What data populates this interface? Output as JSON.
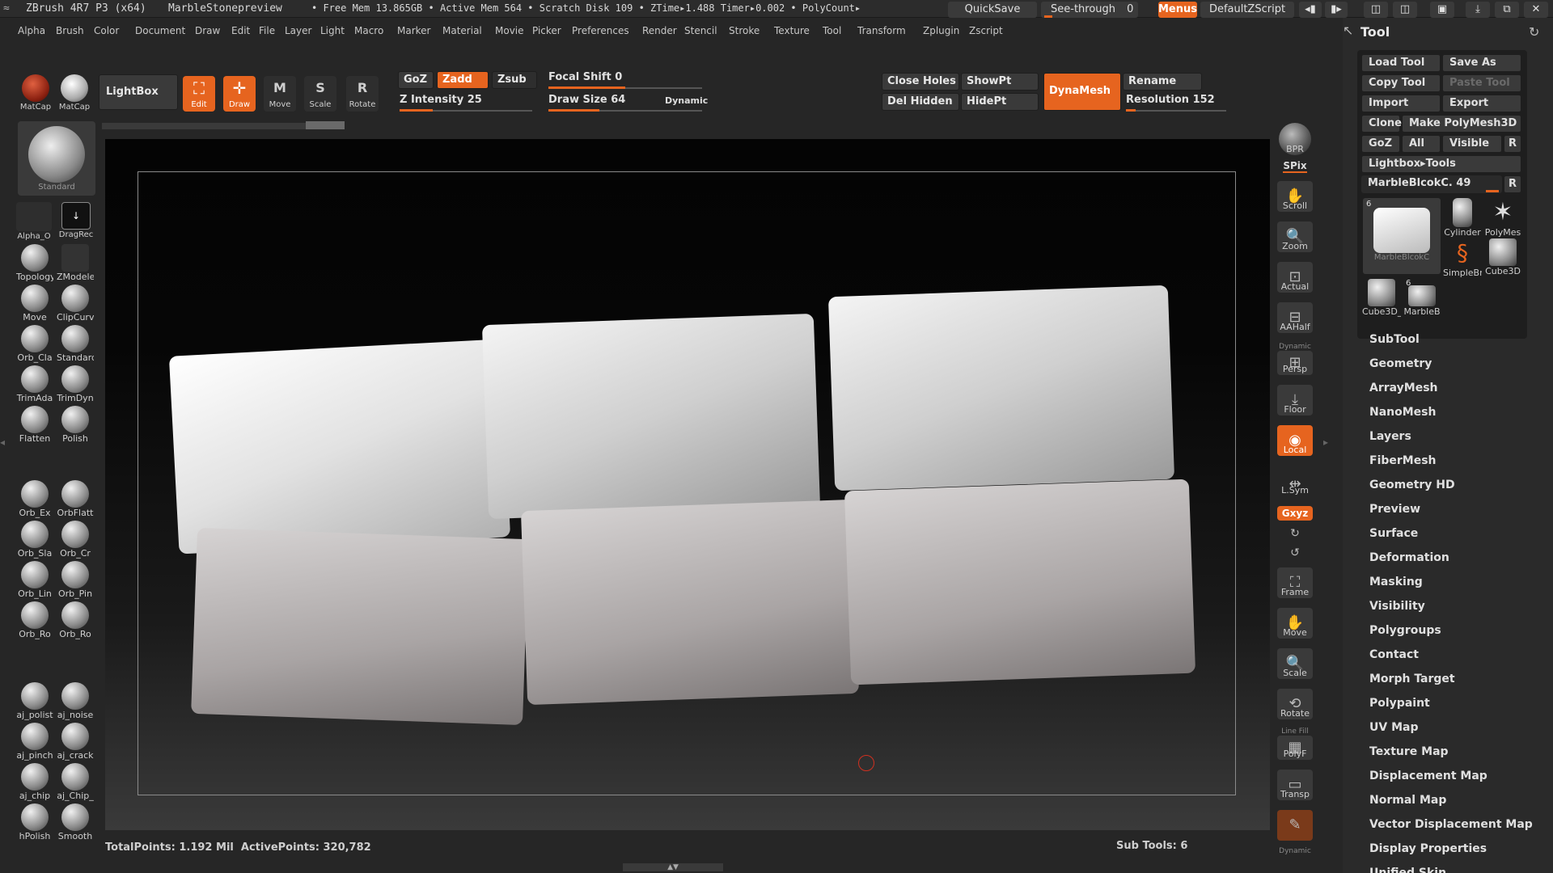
{
  "titlebar": {
    "app": "ZBrush 4R7 P3 (x64)",
    "doc": "MarbleStonepreview",
    "stats": "• Free Mem 13.865GB • Active Mem 564 • Scratch Disk 109 • ZTime▸1.488 Timer▸0.002 • PolyCount▸",
    "quicksave": "QuickSave",
    "seethrough": "See-through",
    "seethrough_value": "0",
    "menus": "Menus",
    "script": "DefaultZScript"
  },
  "menubar": [
    "Alpha",
    "Brush",
    "Color",
    "Document",
    "Draw",
    "Edit",
    "File",
    "Layer",
    "Light",
    "Macro",
    "Marker",
    "Material",
    "Movie",
    "Picker",
    "Preferences",
    "Render",
    "Stencil",
    "Stroke",
    "Texture",
    "Tool",
    "Transform",
    "Zplugin",
    "Zscript"
  ],
  "topshelf": {
    "matcap1": "MatCap",
    "matcap2": "MatCap",
    "lightbox": "LightBox",
    "edit": "Edit",
    "draw": "Draw",
    "move": "Move",
    "scale": "Scale",
    "rotate": "Rotate",
    "goz": "GoZ",
    "zadd": "Zadd",
    "zsub": "Zsub",
    "z_intensity": "Z Intensity 25",
    "focal_shift": "Focal Shift 0",
    "draw_size": "Draw Size 64",
    "dynamic": "Dynamic",
    "close_holes": "Close Holes",
    "del_hidden": "Del Hidden",
    "showpt": "ShowPt",
    "hidept": "HidePt",
    "dynamesh": "DynaMesh",
    "rename": "Rename",
    "resolution": "Resolution 152"
  },
  "sliders": {
    "z_intensity": 0.25,
    "focal_shift": 0.5,
    "draw_size": 0.33,
    "resolution": 0.1
  },
  "leftshelf": {
    "standard": "Standard",
    "alpha": "Alpha_O",
    "dragrect": "DragRec",
    "topology": "Topology",
    "zmodeler": "ZModeler",
    "move": "Move",
    "clipcurve": "ClipCurv",
    "orb_cla": "Orb_Cla",
    "standard2": "Standard",
    "trimada": "TrimAda",
    "trimdyn": "TrimDyn",
    "flatten": "Flatten",
    "polish": "Polish",
    "orb_ex": "Orb_Ex",
    "orbflatt": "OrbFlatt",
    "orb_sla": "Orb_Sla",
    "orb_cr": "Orb_Cr",
    "orb_lin": "Orb_Lin",
    "orb_pin": "Orb_Pin",
    "orb_ro1": "Orb_Ro",
    "orb_ro2": "Orb_Ro",
    "aj_polish": "aj_polist",
    "aj_noise": "aj_noise",
    "aj_pinch": "aj_pinch",
    "aj_crack": "aj_crack",
    "aj_chip": "aj_chip",
    "aj_chip2": "aj_Chip_",
    "hpolish": "hPolish",
    "smooth": "Smooth"
  },
  "rightshelf": {
    "bpr": "BPR",
    "spix": "SPix",
    "scroll": "Scroll",
    "zoom": "Zoom",
    "actual": "Actual",
    "aahalf": "AAHalf",
    "dynamic": "Dynamic",
    "persp": "Persp",
    "floor": "Floor",
    "local": "Local",
    "lsym": "L.Sym",
    "xyz": "Gxyz",
    "frame": "Frame",
    "move": "Move",
    "scale": "Scale",
    "rotate": "Rotate",
    "linefill": "Line Fill",
    "polyf": "PolyF",
    "transp": "Transp",
    "dynamic2": "Dynamic"
  },
  "toolpanel": {
    "title": "Tool",
    "load": "Load Tool",
    "saveas": "Save As",
    "copy": "Copy Tool",
    "paste": "Paste Tool",
    "import": "Import",
    "export": "Export",
    "clone": "Clone",
    "makepoly": "Make PolyMesh3D",
    "goz": "GoZ",
    "all": "All",
    "visible": "Visible",
    "r": "R",
    "lightbox_tools": "Lightbox▸Tools",
    "current": "MarbleBlcokC. 49",
    "current_r": "R",
    "thumbs": [
      "MarbleBlcokC",
      "Cylinder",
      "PolyMes",
      "SimpleBr",
      "Cube3D",
      "Cube3D_",
      "MarbleB"
    ],
    "thumb_count": "6",
    "thumb_count2": "6",
    "menu": [
      "SubTool",
      "Geometry",
      "ArrayMesh",
      "NanoMesh",
      "Layers",
      "FiberMesh",
      "Geometry HD",
      "Preview",
      "Surface",
      "Deformation",
      "Masking",
      "Visibility",
      "Polygroups",
      "Contact",
      "Morph Target",
      "Polypaint",
      "UV Map",
      "Texture Map",
      "Displacement Map",
      "Normal Map",
      "Vector Displacement Map",
      "Display Properties",
      "Unified Skin"
    ]
  },
  "status": {
    "points": "TotalPoints: 1.192 Mil  ActivePoints: 320,782",
    "subtools": "Sub Tools: 6"
  },
  "colors": {
    "accent": "#e6641f",
    "bg": "#262626",
    "panel": "#2a2a2a"
  }
}
